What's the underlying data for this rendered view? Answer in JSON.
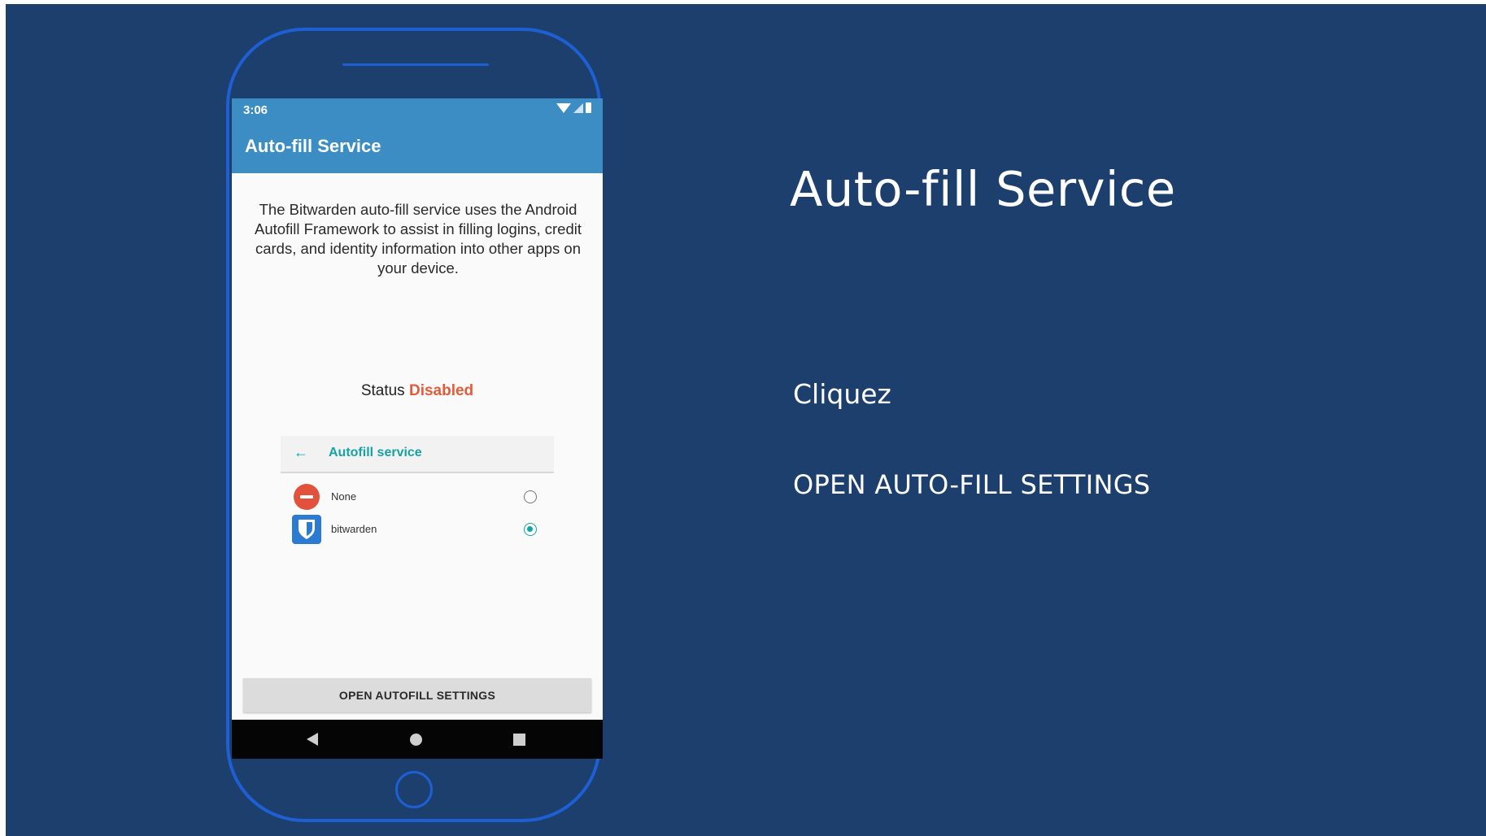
{
  "slide": {
    "title": "Auto-fill Service",
    "instruction_verb": "Cliquez",
    "instruction_target": "OPEN AUTO-FILL SETTINGS",
    "colors": {
      "background": "#1c3f6d",
      "phone_outline": "#1f5fd4"
    }
  },
  "phone": {
    "statusbar": {
      "time": "3:06",
      "icons": [
        "wifi-icon",
        "signal-icon",
        "battery-icon"
      ]
    },
    "appbar": {
      "title": "Auto-fill Service",
      "color": "#3c8dc4"
    },
    "description": "The Bitwarden auto-fill service uses the Android Autofill Framework to assist in filling logins, credit cards, and identity information into other apps on your device.",
    "status": {
      "label": "Status",
      "value": "Disabled",
      "value_color": "#e35b3b"
    },
    "autofill_panel": {
      "title": "Autofill service",
      "options": [
        {
          "label": "None",
          "icon": "none-icon",
          "selected": false
        },
        {
          "label": "bitwarden",
          "icon": "bitwarden-shield-icon",
          "selected": true
        }
      ]
    },
    "button": {
      "label": "OPEN AUTOFILL SETTINGS"
    },
    "navbar": {
      "icons": [
        "nav-back-icon",
        "nav-home-icon",
        "nav-recent-icon"
      ]
    }
  }
}
